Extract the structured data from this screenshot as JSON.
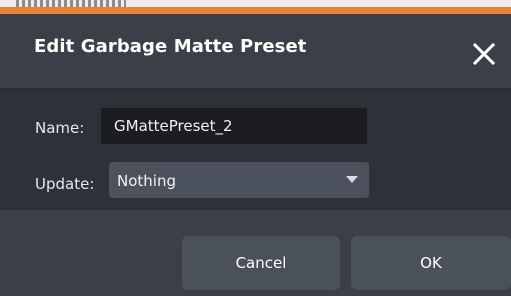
{
  "dialog": {
    "title": "Edit Garbage Matte Preset",
    "close_icon": "close-icon"
  },
  "form": {
    "name_label": "Name:",
    "name_value": "GMattePreset_2",
    "update_label": "Update:",
    "update_selected": "Nothing",
    "update_icon": "chevron-down-icon"
  },
  "footer": {
    "cancel_label": "Cancel",
    "ok_label": "OK"
  },
  "colors": {
    "accent_strip": "#e98434",
    "dialog_header": "#3b4048",
    "dialog_body": "#2e3238",
    "input_bg": "#1c1d20",
    "button_bg": "#4a515b"
  }
}
